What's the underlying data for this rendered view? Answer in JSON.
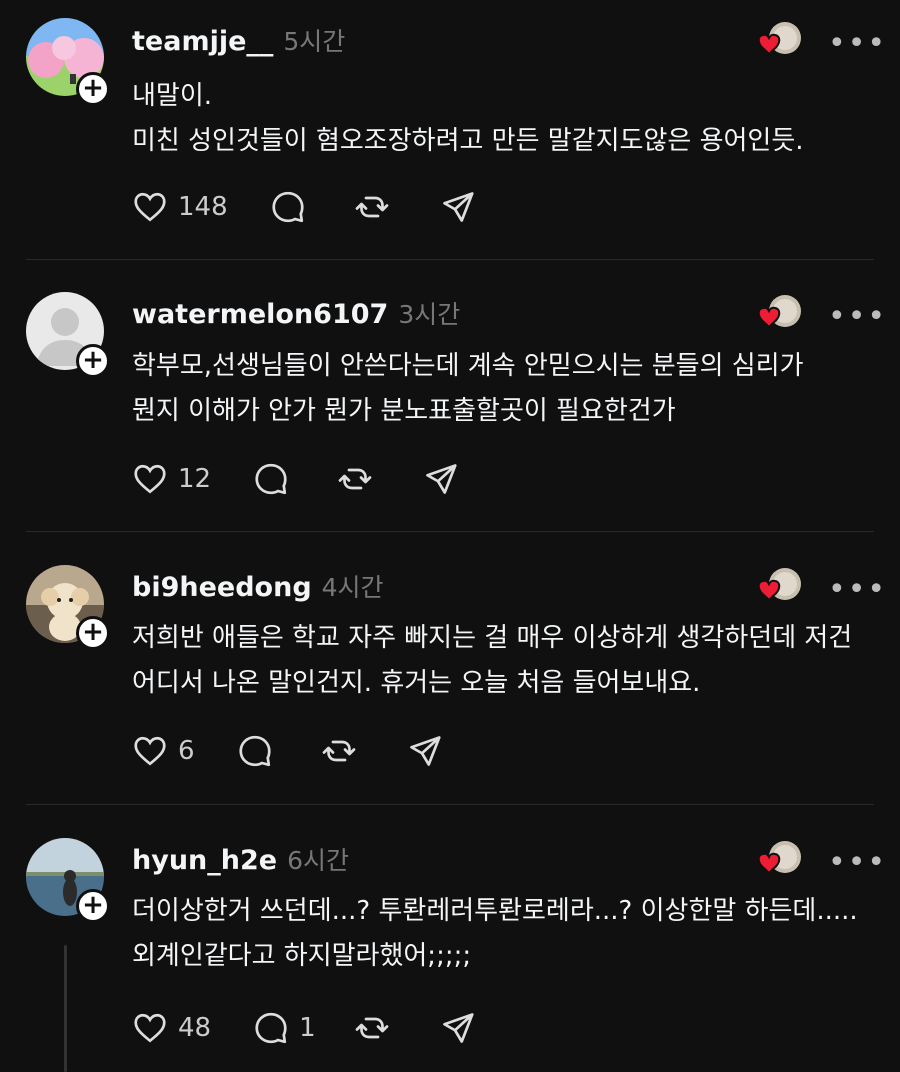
{
  "posts": [
    {
      "username": "teamjje__",
      "time": "5시간",
      "text": "내말이.\n미친 성인것들이 혐오조장하려고 만든 말같지도않은 용어인듯.",
      "likes": "148",
      "replies": ""
    },
    {
      "username": "watermelon6107",
      "time": "3시간",
      "text": "학부모,선생님들이 안쓴다는데 계속 안믿으시는 분들의 심리가\n뭔지 이해가 안가 뭔가 분노표출할곳이 필요한건가",
      "likes": "12",
      "replies": ""
    },
    {
      "username": "bi9heedong",
      "time": "4시간",
      "text": "저희반 애들은 학교 자주 빠지는 걸 매우 이상하게 생각하던데 저건\n어디서 나온 말인건지. 휴거는 오늘 처음 들어보내요.",
      "likes": "6",
      "replies": ""
    },
    {
      "username": "hyun_h2e",
      "time": "6시간",
      "text": "더이상한거 쓰던데...? 투롼레러투롼로레라...? 이상한말 하든데.....\n외계인같다고 하지말라했어;;;;;",
      "likes": "48",
      "replies": "1"
    }
  ],
  "icons": {
    "like": "heart-icon",
    "reply": "comment-icon",
    "repost": "repost-icon",
    "share": "send-icon",
    "more": "more-icon",
    "follow": "plus-icon"
  },
  "more_label": "•••",
  "follow_label": "+"
}
